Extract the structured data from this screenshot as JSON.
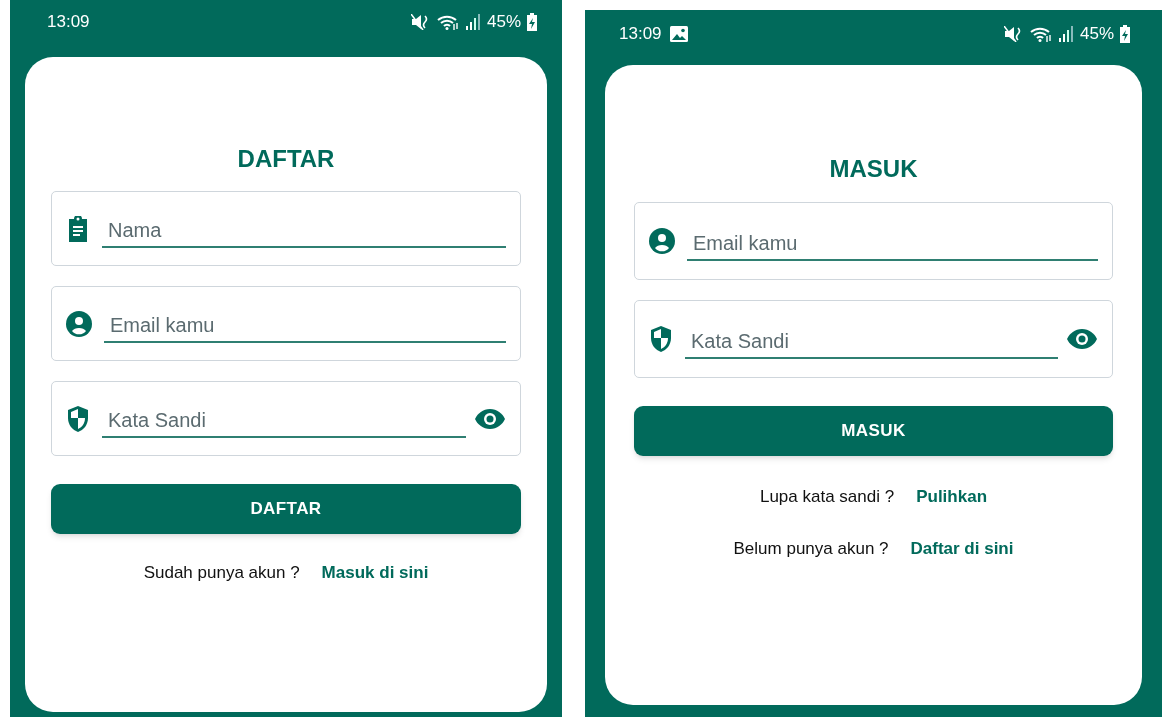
{
  "screens": [
    {
      "status_bar": {
        "time": "13:09",
        "has_image_notification": false,
        "battery": "45%"
      },
      "title": "DAFTAR",
      "fields": [
        {
          "kind": "name",
          "placeholder": "Nama"
        },
        {
          "kind": "email",
          "placeholder": "Email kamu"
        },
        {
          "kind": "password",
          "placeholder": "Kata Sandi"
        }
      ],
      "button": "DAFTAR",
      "prompts": [
        {
          "text": "Sudah punya akun ?",
          "link": "Masuk di sini"
        }
      ]
    },
    {
      "status_bar": {
        "time": "13:09",
        "has_image_notification": true,
        "battery": "45%"
      },
      "title": "MASUK",
      "fields": [
        {
          "kind": "email",
          "placeholder": "Email kamu"
        },
        {
          "kind": "password",
          "placeholder": "Kata Sandi"
        }
      ],
      "button": "MASUK",
      "prompts": [
        {
          "text": "Lupa kata sandi ?",
          "link": "Pulihkan"
        },
        {
          "text": "Belum punya akun ?",
          "link": "Daftar di sini"
        }
      ]
    }
  ]
}
